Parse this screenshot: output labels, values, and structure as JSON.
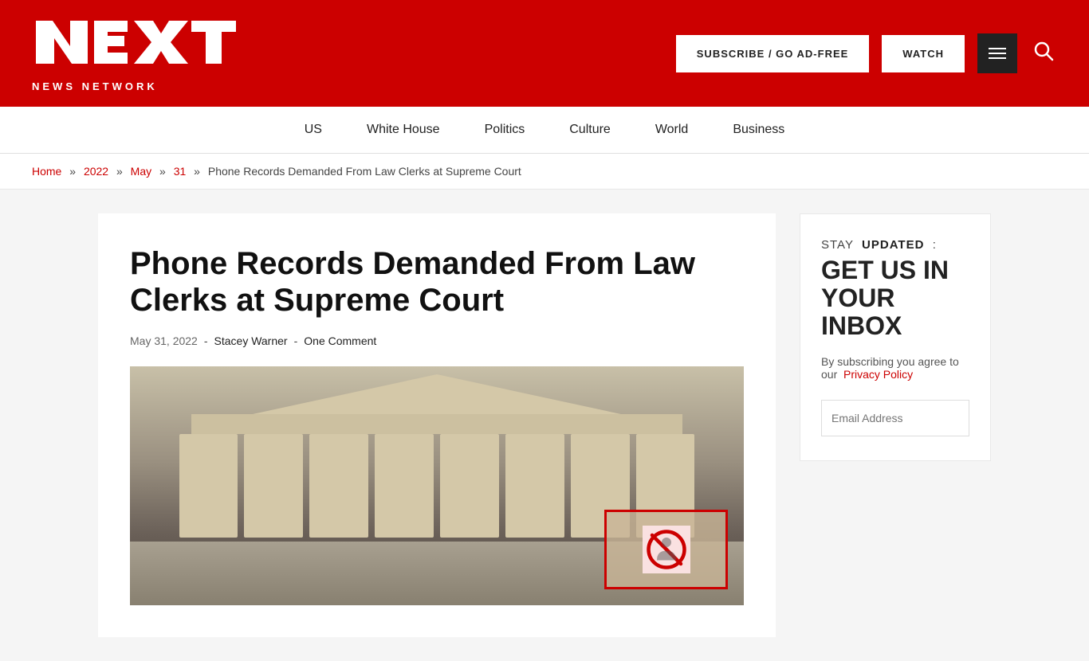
{
  "header": {
    "logo_main": "NEXT",
    "logo_sub": "NEWS NETWORK",
    "subscribe_label": "SUBSCRIBE / GO AD-FREE",
    "watch_label": "WATCH"
  },
  "nav": {
    "items": [
      {
        "label": "US"
      },
      {
        "label": "White House"
      },
      {
        "label": "Politics"
      },
      {
        "label": "Culture"
      },
      {
        "label": "World"
      },
      {
        "label": "Business"
      }
    ]
  },
  "breadcrumb": {
    "home": "Home",
    "year": "2022",
    "month": "May",
    "day": "31",
    "current": "Phone Records Demanded From Law Clerks at Supreme Court"
  },
  "article": {
    "title": "Phone Records Demanded From Law Clerks at Supreme Court",
    "date": "May 31, 2022",
    "author": "Stacey Warner",
    "comments": "One Comment"
  },
  "sidebar": {
    "stay_label": "STAY",
    "updated_label": "UPDATED",
    "heading_line1": "GET US IN",
    "heading_line2": "YOUR",
    "heading_line3": "INBOX",
    "desc": "By subscribing you agree to our",
    "privacy_label": "Privacy Policy",
    "email_placeholder": "Email Address"
  }
}
